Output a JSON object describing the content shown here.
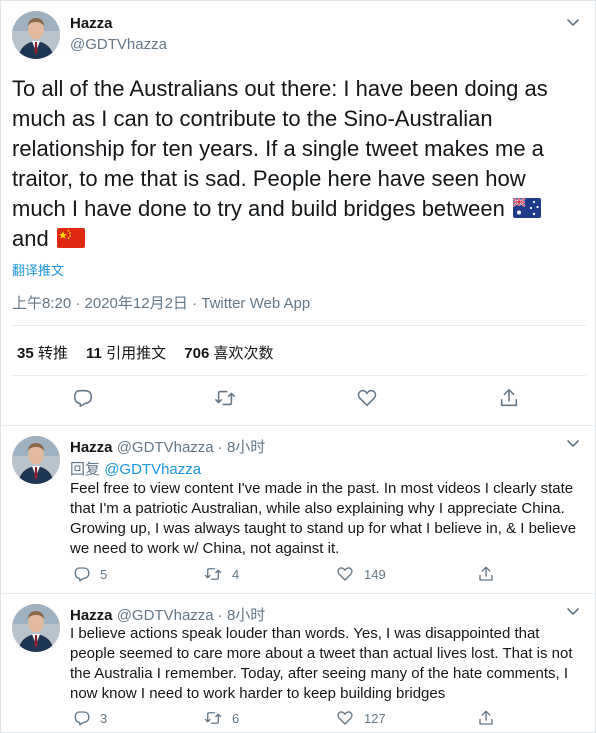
{
  "main_tweet": {
    "name": "Hazza",
    "handle": "@GDTVhazza",
    "text_lines": [
      "To all of the Australians out there: I have been doing as",
      "much as I can to contribute to the Sino-Australian",
      "relationship for ten years. If a single tweet makes me a",
      "traitor, to me that is sad. People here have seen how",
      "much I have done to try and build bridges between",
      "and"
    ],
    "flags": [
      "australia-flag-icon",
      "china-flag-icon"
    ],
    "translate_label": "翻译推文",
    "timestamp": "上午8:20 · 2020年12月2日 · Twitter Web App",
    "stats": {
      "retweets_count": "35",
      "retweets_label": "转推",
      "quotes_count": "11",
      "quotes_label": "引用推文",
      "likes_count": "706",
      "likes_label": "喜欢次数"
    },
    "actions": [
      "reply-icon",
      "retweet-icon",
      "like-icon",
      "share-icon"
    ]
  },
  "replies": [
    {
      "name": "Hazza",
      "handle": "@GDTVhazza",
      "time": "8小时",
      "reply_prefix": "回复",
      "reply_mention": "@GDTVhazza",
      "lines": [
        "Feel free to view content I've made in the past. In most videos I clearly state",
        "that I'm a patriotic Australian, while also explaining why I appreciate China.",
        "Growing up, I was always taught to stand up for what I believe in, & I believe",
        "we need to work w/ China, not against it."
      ],
      "reply_count": "5",
      "retweet_count": "4",
      "like_count": "149"
    },
    {
      "name": "Hazza",
      "handle": "@GDTVhazza",
      "time": "8小时",
      "lines": [
        "I believe actions speak louder than words. Yes, I was disappointed that",
        "people seemed to care more about a tweet than actual lives lost. That is not",
        "the Australia I remember. Today, after seeing many of the hate comments, I",
        "now know I need to work harder to keep building bridges"
      ],
      "reply_count": "3",
      "retweet_count": "6",
      "like_count": "127"
    }
  ],
  "colors": {
    "text": "#14171a",
    "secondary": "#657786",
    "link": "#1b95e0",
    "divider": "#e6ecf0"
  }
}
